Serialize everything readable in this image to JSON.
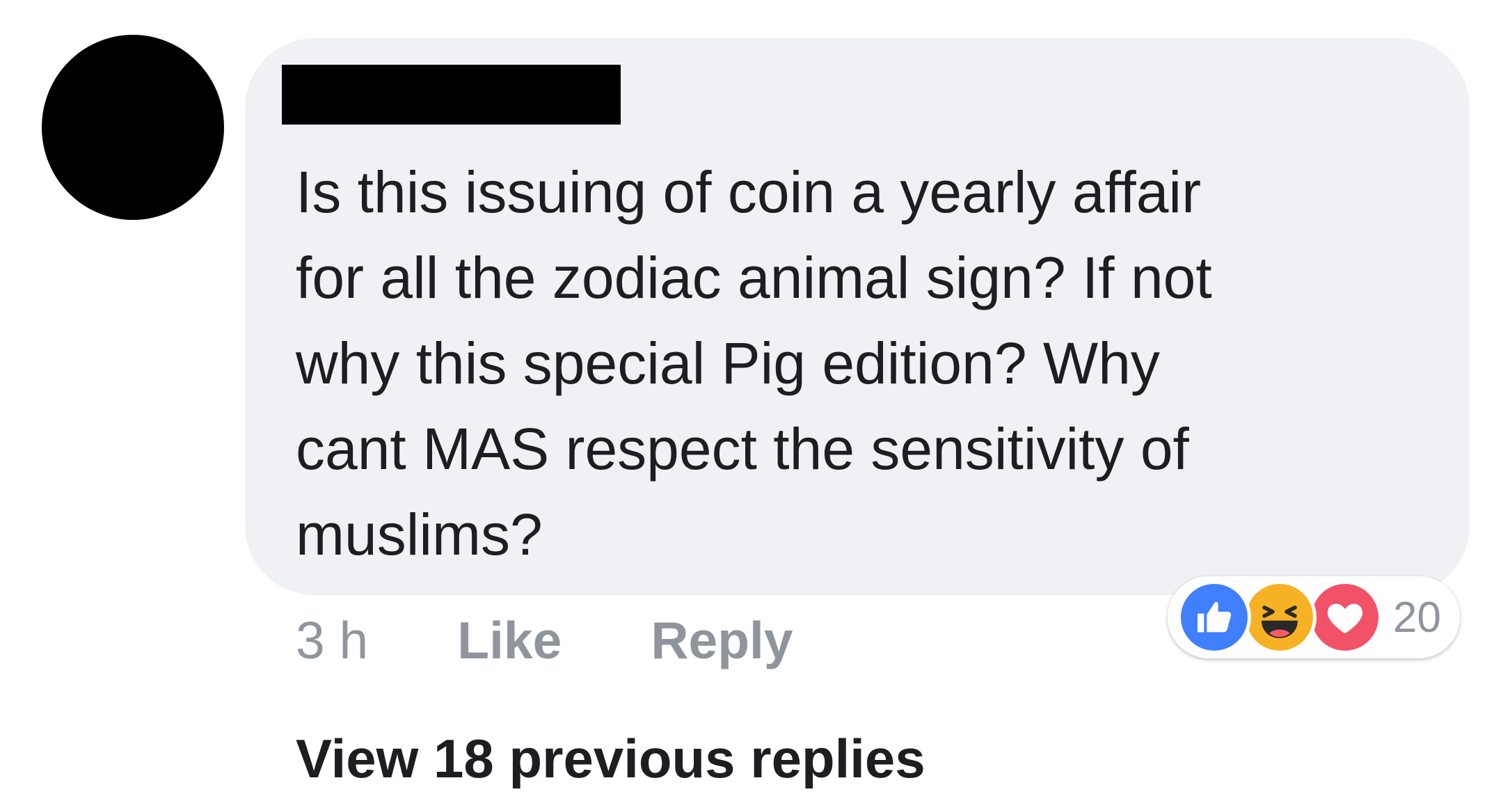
{
  "comment": {
    "text": "Is this issuing of coin a yearly affair\nfor all the zodiac animal sign? If not\nwhy this special Pig edition? Why\ncant MAS respect the sensitivity of\nmuslims?",
    "timestamp": "3 h",
    "like_label": "Like",
    "reply_label": "Reply"
  },
  "reactions": {
    "icons": [
      "like-icon",
      "haha-icon",
      "love-icon"
    ],
    "count": "20",
    "colors": {
      "like": "#4080ff",
      "haha": "#f7b125",
      "love": "#f25268"
    }
  },
  "replies": {
    "view_label": "View 18 previous replies"
  }
}
